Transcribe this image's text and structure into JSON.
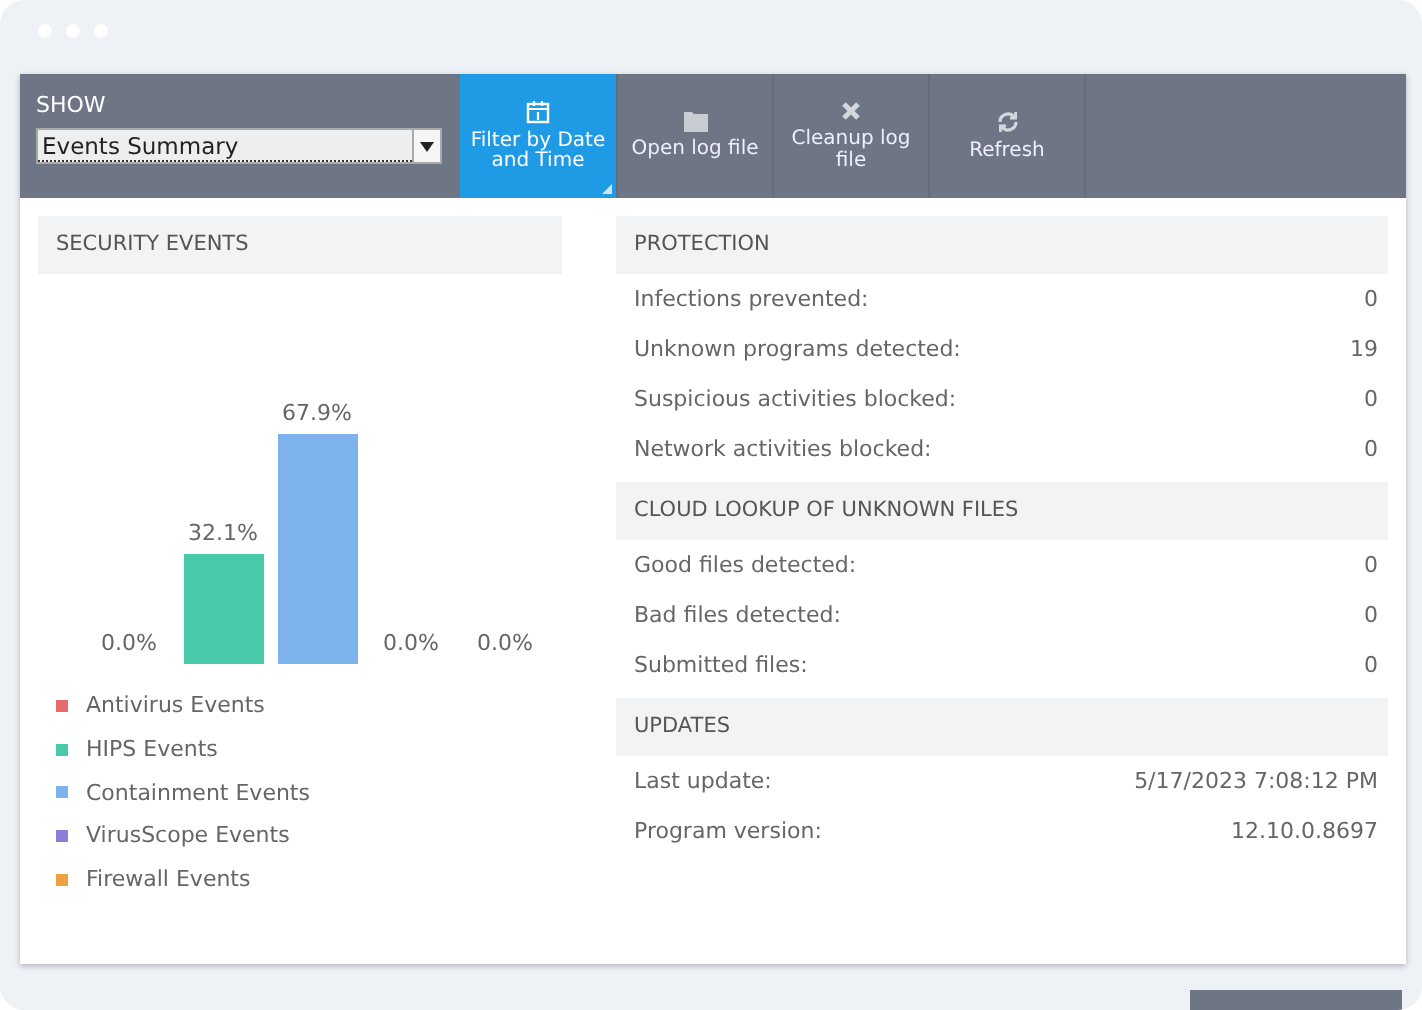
{
  "toolbar": {
    "show": {
      "label": "SHOW",
      "value": "Events Summary"
    },
    "buttons": [
      {
        "label": "Filter by Date and Time",
        "kind": "calendar",
        "selected": true
      },
      {
        "label": "Open log file",
        "kind": "folder",
        "selected": false
      },
      {
        "label": "Cleanup log file",
        "kind": "cross",
        "selected": false
      },
      {
        "label": "Refresh",
        "kind": "refresh",
        "selected": false
      }
    ]
  },
  "security_events": {
    "title": "SECURITY EVENTS",
    "bars": [
      {
        "reading": "0.0%"
      },
      {
        "reading": "32.1%"
      },
      {
        "reading": "67.9%"
      },
      {
        "reading": "0.0%"
      },
      {
        "reading": "0.0%"
      }
    ],
    "legend": [
      {
        "label": "Antivirus Events",
        "color": "#e86a6a"
      },
      {
        "label": "HIPS Events",
        "color": "#48c9a9"
      },
      {
        "label": "Containment Events",
        "color": "#7eb2ec"
      },
      {
        "label": "VirusScope Events",
        "color": "#8a7fd6"
      },
      {
        "label": "Firewall Events",
        "color": "#eda140"
      }
    ]
  },
  "sections": [
    {
      "title": "PROTECTION",
      "rows": [
        {
          "label": "Infections prevented:",
          "value": "0"
        },
        {
          "label": "Unknown programs detected:",
          "value": "19"
        },
        {
          "label": "Suspicious activities blocked:",
          "value": "0"
        },
        {
          "label": "Network activities blocked:",
          "value": "0"
        }
      ]
    },
    {
      "title": "CLOUD LOOKUP OF UNKNOWN FILES",
      "rows": [
        {
          "label": "Good files detected:",
          "value": "0"
        },
        {
          "label": "Bad files detected:",
          "value": "0"
        },
        {
          "label": "Submitted files:",
          "value": "0"
        }
      ]
    },
    {
      "title": "UPDATES",
      "rows": [
        {
          "label": "Last update:",
          "value": "5/17/2023 7:08:12 PM"
        },
        {
          "label": "Program version:",
          "value": "12.10.0.8697"
        }
      ]
    }
  ]
}
